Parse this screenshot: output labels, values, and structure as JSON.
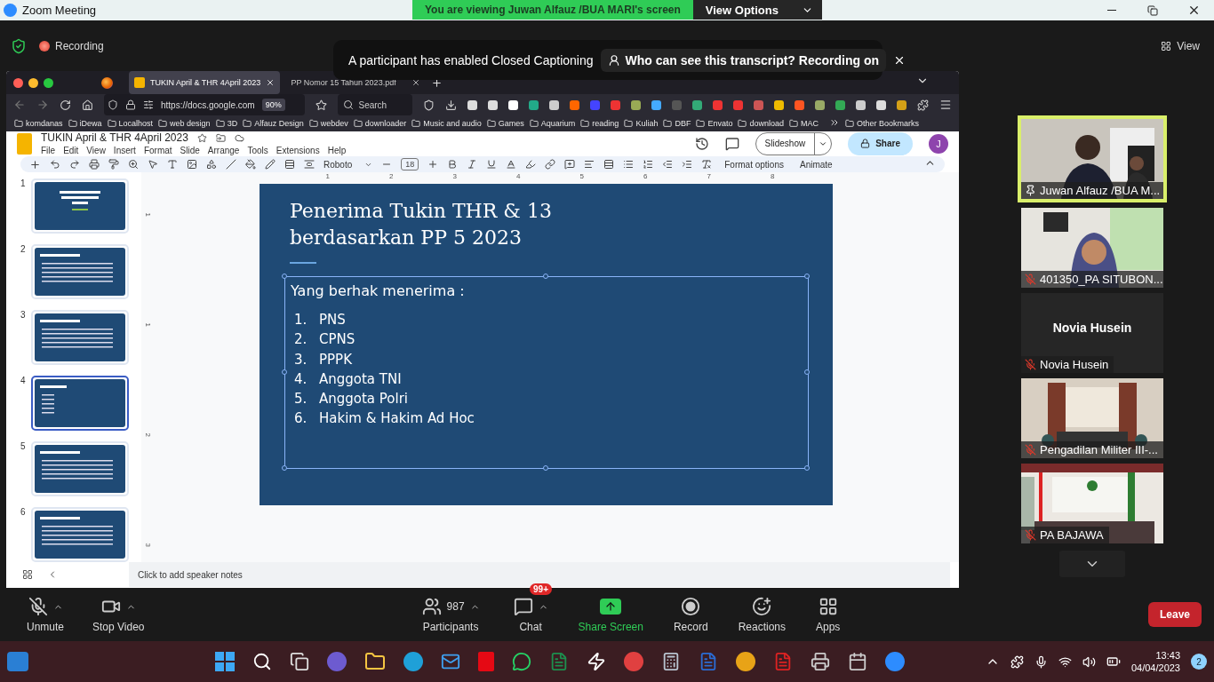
{
  "window": {
    "title": "Zoom Meeting"
  },
  "share_banner": {
    "text": "You are viewing Juwan Alfauz /BUA MARI's screen",
    "button": "View Options"
  },
  "meeting_bar": {
    "recording": "Recording",
    "view": "View"
  },
  "notification": {
    "message": "A participant has enabled Closed Captioning",
    "link": "Who can see this transcript? Recording on"
  },
  "browser": {
    "tabs": [
      {
        "label": "TUKIN April & THR 4April 2023",
        "selected": true
      },
      {
        "label": "PP Nomor 15 Tahun 2023.pdf",
        "selected": false
      }
    ],
    "address": "https://docs.google.com",
    "zoom": "90%",
    "search_placeholder": "Search",
    "bookmarks": [
      "komdanas",
      "iDewa",
      "Localhost",
      "web design",
      "3D",
      "Alfauz Design",
      "webdev",
      "downloader",
      "Music and audio",
      "Games",
      "Aquarium",
      "reading",
      "Kuliah",
      "DBF",
      "Envato",
      "download",
      "MAC"
    ],
    "other_bookmarks": "Other Bookmarks"
  },
  "doc": {
    "title": "TUKIN April & THR 4April 2023",
    "menu": [
      "File",
      "Edit",
      "View",
      "Insert",
      "Format",
      "Slide",
      "Arrange",
      "Tools",
      "Extensions",
      "Help"
    ],
    "slideshow": "Slideshow",
    "share": "Share",
    "avatar": "J",
    "toolbar": {
      "font": "Roboto",
      "font_size": "18",
      "format_options": "Format options",
      "animate": "Animate"
    },
    "ruler": [
      "1",
      "2",
      "3",
      "4",
      "5",
      "6",
      "7",
      "8"
    ],
    "vertical_ruler": [
      "1",
      "1",
      "2",
      "3"
    ],
    "slides": [
      {
        "number": "1",
        "selected": false
      },
      {
        "number": "2",
        "selected": false
      },
      {
        "number": "3",
        "selected": false
      },
      {
        "number": "4",
        "selected": true
      },
      {
        "number": "5",
        "selected": false
      },
      {
        "number": "6",
        "selected": false
      }
    ],
    "slide": {
      "title_lines": [
        "Penerima Tukin THR & 13",
        "berdasarkan PP 5 2023"
      ],
      "intro": "Yang berhak menerima :",
      "items": [
        {
          "number": "1.",
          "text": "PNS"
        },
        {
          "number": "2.",
          "text": "CPNS"
        },
        {
          "number": "3.",
          "text": "PPPK"
        },
        {
          "number": "4.",
          "text": "Anggota TNI"
        },
        {
          "number": "5.",
          "text": "Anggota Polri"
        },
        {
          "number": "6.",
          "text": "Hakim & Hakim Ad Hoc"
        }
      ]
    },
    "notes_placeholder": "Click to add speaker notes"
  },
  "participants": [
    {
      "kind": "video",
      "name": "Juwan Alfauz /BUA M...",
      "active": true,
      "muted": false
    },
    {
      "kind": "video",
      "name": "401350_PA SITUBON...",
      "active": false,
      "muted": true
    },
    {
      "kind": "avatar",
      "display_name": "Novia Husein",
      "name": "Novia Husein",
      "active": false,
      "muted": true
    },
    {
      "kind": "video",
      "name": "Pengadilan Militer III-...",
      "active": false,
      "muted": true
    },
    {
      "kind": "video",
      "name": "PA BAJAWA",
      "active": false,
      "muted": true
    }
  ],
  "controls": [
    {
      "kind": "unmute",
      "label": "Unmute",
      "has_menu": true
    },
    {
      "kind": "video",
      "label": "Stop Video",
      "has_menu": true
    },
    {
      "kind": "participants",
      "label": "Participants",
      "count": "987",
      "has_menu": true
    },
    {
      "kind": "chat",
      "label": "Chat",
      "badge": "99+",
      "has_menu": true
    },
    {
      "kind": "share",
      "label": "Share Screen",
      "has_menu": false
    },
    {
      "kind": "record",
      "label": "Record",
      "has_menu": false
    },
    {
      "kind": "reactions",
      "label": "Reactions",
      "has_menu": false
    },
    {
      "kind": "apps",
      "label": "Apps",
      "has_menu": false
    }
  ],
  "leave": "Leave",
  "taskbar": {
    "time": "13:43",
    "date": "04/04/2023",
    "notifications": "2"
  }
}
